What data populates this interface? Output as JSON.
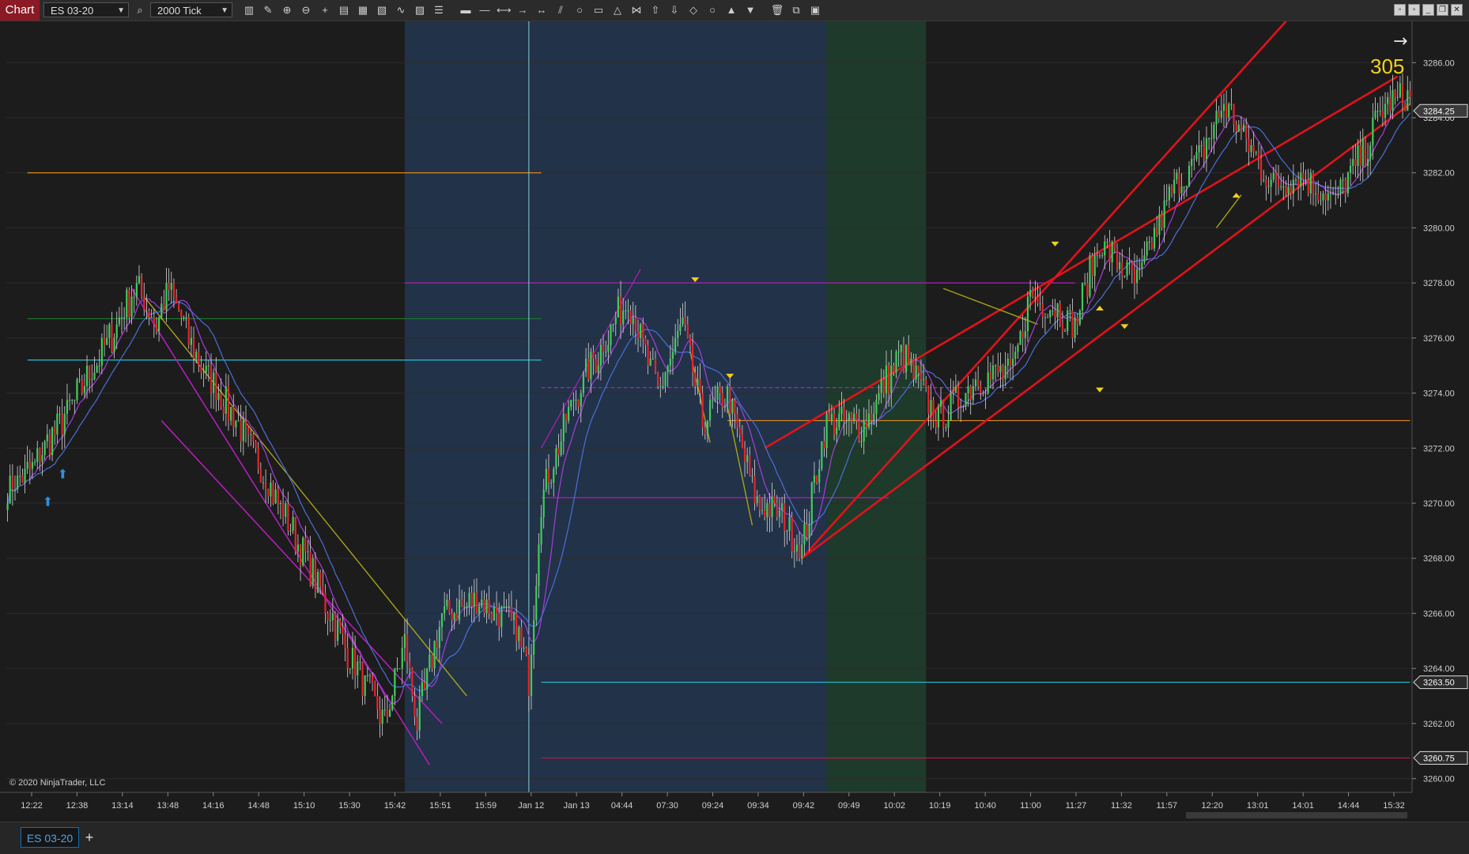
{
  "toolbar": {
    "chart_label": "Chart",
    "instrument": "ES 03-20",
    "interval": "2000 Tick",
    "tools": [
      "bars-icon",
      "pencil-icon",
      "zoom-in-icon",
      "zoom-out-icon",
      "crosshair-icon",
      "data-box-icon",
      "indicators-icon",
      "strategies-icon",
      "plot-icon",
      "properties-icon",
      "list-icon",
      "ruler-icon",
      "line-icon",
      "extended-line-icon",
      "arrow-line-icon",
      "ray-icon",
      "trend-channel-icon",
      "ellipse-icon",
      "rectangle-icon",
      "triangle-icon",
      "fibonacci-icon",
      "arrow-up-icon",
      "arrow-down-icon",
      "diamond-icon",
      "dot-icon",
      "triangle-up-icon",
      "triangle-down-icon",
      "trash-icon",
      "copy-icon",
      "template-icon"
    ]
  },
  "tabs": {
    "active": "ES 03-20",
    "add": "+"
  },
  "copyright": "© 2020 NinjaTrader, LLC",
  "counter": "305",
  "nav_arrow": "→",
  "chart_data": {
    "type": "candlestick",
    "instrument": "ES 03-20",
    "interval": "2000 Tick",
    "ylim": [
      3259.5,
      3287.5
    ],
    "y_ticks": [
      "3286.00",
      "3284.00",
      "3282.00",
      "3280.00",
      "3278.00",
      "3276.00",
      "3274.00",
      "3272.00",
      "3270.00",
      "3268.00",
      "3266.00",
      "3264.00",
      "3262.00",
      "3260.00"
    ],
    "x_ticks": [
      "12:22",
      "12:38",
      "13:14",
      "13:48",
      "14:16",
      "14:48",
      "15:10",
      "15:30",
      "15:42",
      "15:51",
      "15:59",
      "Jan 12",
      "Jan 13",
      "04:44",
      "07:30",
      "09:24",
      "09:34",
      "09:42",
      "09:49",
      "10:02",
      "10:19",
      "10:40",
      "11:00",
      "11:27",
      "11:32",
      "11:57",
      "12:20",
      "13:01",
      "14:01",
      "14:44",
      "15:32"
    ],
    "price_markers": [
      {
        "label": "3284.25",
        "value": 3284.25,
        "color": "#3a3a3a"
      },
      {
        "label": "3263.50",
        "value": 3263.5,
        "color": "#2a2a2a"
      },
      {
        "label": "3260.75",
        "value": 3260.75,
        "color": "#2a2a2a"
      }
    ],
    "horizontal_levels": [
      {
        "value": 3282.0,
        "color": "#e08a1e"
      },
      {
        "value": 3278.0,
        "color": "#b01fb8"
      },
      {
        "value": 3276.7,
        "color": "#1d7a2e"
      },
      {
        "value": 3275.2,
        "color": "#21c3d6"
      },
      {
        "value": 3274.2,
        "color": "#b01fb8"
      },
      {
        "value": 3273.0,
        "color": "#e08a1e"
      },
      {
        "value": 3270.2,
        "color": "#b01fb8"
      },
      {
        "value": 3263.5,
        "color": "#21c3d6"
      },
      {
        "value": 3260.75,
        "color": "#c4184a"
      }
    ],
    "waypoints": [
      [
        0,
        3270.5
      ],
      [
        10,
        3271.3
      ],
      [
        22,
        3273.0
      ],
      [
        40,
        3275.8
      ],
      [
        52,
        3277.9
      ],
      [
        60,
        3276.5
      ],
      [
        65,
        3277.9
      ],
      [
        75,
        3275.5
      ],
      [
        95,
        3272.5
      ],
      [
        115,
        3269.0
      ],
      [
        135,
        3265.0
      ],
      [
        152,
        3262.0
      ],
      [
        160,
        3265.0
      ],
      [
        165,
        3262.0
      ],
      [
        175,
        3266.0
      ],
      [
        190,
        3266.5
      ],
      [
        205,
        3265.5
      ],
      [
        210,
        3263.6
      ],
      [
        215,
        3270.2
      ],
      [
        228,
        3273.8
      ],
      [
        240,
        3275.8
      ],
      [
        250,
        3277.5
      ],
      [
        262,
        3274.0
      ],
      [
        272,
        3276.5
      ],
      [
        280,
        3273.0
      ],
      [
        290,
        3274.0
      ],
      [
        302,
        3270.0
      ],
      [
        312,
        3269.5
      ],
      [
        320,
        3268.3
      ],
      [
        330,
        3273.0
      ],
      [
        345,
        3272.8
      ],
      [
        360,
        3275.5
      ],
      [
        375,
        3273.0
      ],
      [
        390,
        3274.5
      ],
      [
        405,
        3274.8
      ],
      [
        412,
        3277.5
      ],
      [
        420,
        3277.2
      ],
      [
        430,
        3276.5
      ],
      [
        440,
        3279.5
      ],
      [
        455,
        3278.0
      ],
      [
        470,
        3281.5
      ],
      [
        480,
        3282.5
      ],
      [
        490,
        3284.5
      ],
      [
        500,
        3283.0
      ],
      [
        510,
        3281.5
      ],
      [
        520,
        3282.0
      ],
      [
        535,
        3281.0
      ],
      [
        545,
        3282.5
      ],
      [
        555,
        3284.5
      ],
      [
        565,
        3284.8
      ]
    ]
  }
}
